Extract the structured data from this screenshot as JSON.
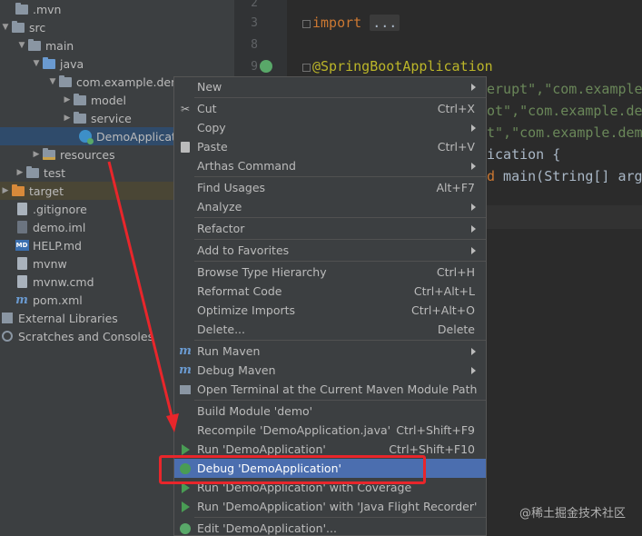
{
  "tree": {
    "items": [
      {
        "label": ".mvn"
      },
      {
        "label": "src"
      },
      {
        "label": "main"
      },
      {
        "label": "java"
      },
      {
        "label": "com.example.demo"
      },
      {
        "label": "model"
      },
      {
        "label": "service"
      },
      {
        "label": "DemoApplication"
      },
      {
        "label": "resources"
      },
      {
        "label": "test"
      },
      {
        "label": "target"
      },
      {
        "label": ".gitignore"
      },
      {
        "label": "demo.iml"
      },
      {
        "label": "HELP.md"
      },
      {
        "label": "mvnw"
      },
      {
        "label": "mvnw.cmd"
      },
      {
        "label": "pom.xml"
      },
      {
        "label": "External Libraries"
      },
      {
        "label": "Scratches and Consoles"
      }
    ]
  },
  "editor": {
    "line_numbers": [
      "2",
      "3",
      "8",
      "9"
    ],
    "code": {
      "import_kw": "import",
      "import_fold": "...",
      "annotation": "@SpringBootApplication",
      "str1": "erupt\",\"com.example",
      "str2": "ot\",\"com.example.dem",
      "str3": "t\",\"com.example.demo",
      "class_decl": "ication {",
      "main_kw": "d",
      "main_rest": " main(String[] args"
    }
  },
  "menu": {
    "items": [
      {
        "label": "New",
        "shortcut": ""
      },
      {
        "label": "Cut",
        "shortcut": "Ctrl+X"
      },
      {
        "label": "Copy",
        "shortcut": ""
      },
      {
        "label": "Paste",
        "shortcut": "Ctrl+V"
      },
      {
        "label": "Arthas Command",
        "shortcut": ""
      },
      {
        "label": "Find Usages",
        "shortcut": "Alt+F7"
      },
      {
        "label": "Analyze",
        "shortcut": ""
      },
      {
        "label": "Refactor",
        "shortcut": ""
      },
      {
        "label": "Add to Favorites",
        "shortcut": ""
      },
      {
        "label": "Browse Type Hierarchy",
        "shortcut": "Ctrl+H"
      },
      {
        "label": "Reformat Code",
        "shortcut": "Ctrl+Alt+L"
      },
      {
        "label": "Optimize Imports",
        "shortcut": "Ctrl+Alt+O"
      },
      {
        "label": "Delete...",
        "shortcut": "Delete"
      },
      {
        "label": "Run Maven",
        "shortcut": ""
      },
      {
        "label": "Debug Maven",
        "shortcut": ""
      },
      {
        "label": "Open Terminal at the Current Maven Module Path",
        "shortcut": ""
      },
      {
        "label": "Build Module 'demo'",
        "shortcut": ""
      },
      {
        "label": "Recompile 'DemoApplication.java'",
        "shortcut": "Ctrl+Shift+F9"
      },
      {
        "label": "Run 'DemoApplication'",
        "shortcut": "Ctrl+Shift+F10"
      },
      {
        "label": "Debug 'DemoApplication'",
        "shortcut": ""
      },
      {
        "label": "Run 'DemoApplication' with Coverage",
        "shortcut": ""
      },
      {
        "label": "Run 'DemoApplication' with 'Java Flight Recorder'",
        "shortcut": ""
      },
      {
        "label": "Edit 'DemoApplication'...",
        "shortcut": ""
      }
    ]
  },
  "watermark": "@稀土掘金技术社区",
  "colors": {
    "tree_bg": "#3c3f41",
    "editor_bg": "#2b2b2b",
    "menu_bg": "#3c3f41",
    "menu_active": "#4b6eaf",
    "annotation_red": "#e8262b"
  }
}
